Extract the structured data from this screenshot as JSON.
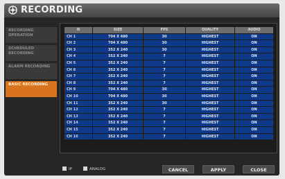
{
  "window": {
    "title": "RECORDING",
    "icon": "gear-icon"
  },
  "sidebar": {
    "items": [
      {
        "label": "RECORDING OPERATION",
        "active": false
      },
      {
        "label": "SCHEDULED RECORDING",
        "active": false
      },
      {
        "label": "ALARM RECORDING",
        "active": false
      },
      {
        "label": "BASIC RECORDING",
        "active": true
      }
    ]
  },
  "table": {
    "columns": [
      "N",
      "SIZE",
      "FPS",
      "QUALITY",
      "AUDIO"
    ],
    "rows": [
      [
        "CH 1",
        "704 X 480",
        "30",
        "HIGHEST",
        "ON"
      ],
      [
        "CH 2",
        "704 X 480",
        "30",
        "HIGHEST",
        "ON"
      ],
      [
        "CH 3",
        "352 X 240",
        "30",
        "HIGHEST",
        "ON"
      ],
      [
        "CH 4",
        "352 X 240",
        "7",
        "HIGHEST",
        "ON"
      ],
      [
        "CH 5",
        "352 X 240",
        "7",
        "HIGHEST",
        "ON"
      ],
      [
        "CH 6",
        "352 X 240",
        "7",
        "HIGHEST",
        "ON"
      ],
      [
        "CH 7",
        "352 X 240",
        "7",
        "HIGHEST",
        "ON"
      ],
      [
        "CH 8",
        "352 X 240",
        "7",
        "HIGHEST",
        "ON"
      ],
      [
        "CH 9",
        "704 X 480",
        "30",
        "HIGHEST",
        "ON"
      ],
      [
        "CH 10",
        "704 X 480",
        "30",
        "HIGHEST",
        "ON"
      ],
      [
        "CH 11",
        "352 X 240",
        "30",
        "HIGHEST",
        "ON"
      ],
      [
        "CH 12",
        "352 X 240",
        "7",
        "HIGHEST",
        "ON"
      ],
      [
        "CH 13",
        "352 X 240",
        "7",
        "HIGHEST",
        "ON"
      ],
      [
        "CH 14",
        "352 X 240",
        "7",
        "HIGHEST",
        "ON"
      ],
      [
        "CH 15",
        "352 X 240",
        "7",
        "HIGHEST",
        "ON"
      ],
      [
        "CH 16",
        "352 X 240",
        "7",
        "HIGHEST",
        "ON"
      ]
    ]
  },
  "footer": {
    "legend": [
      "IP",
      "ANALOG"
    ],
    "buttons": [
      "CANCEL",
      "APPLY",
      "CLOSE"
    ]
  },
  "colors": {
    "accent": "#d9741e",
    "table_cell": "#0f3a8a",
    "header_cell": "#6e6e6e",
    "background": "#262626"
  }
}
